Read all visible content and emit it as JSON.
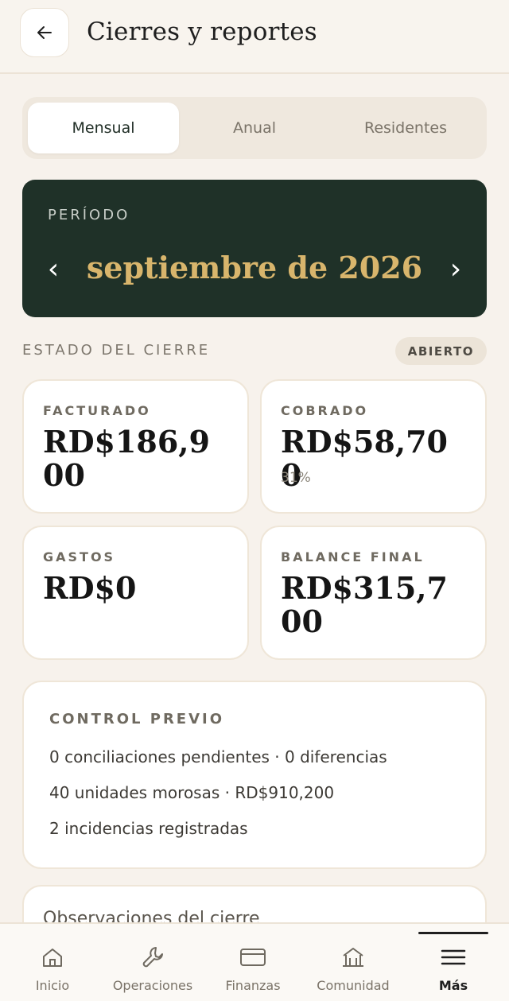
{
  "header": {
    "title": "Cierres y reportes"
  },
  "tabs": [
    {
      "label": "Mensual",
      "active": true
    },
    {
      "label": "Anual",
      "active": false
    },
    {
      "label": "Residentes",
      "active": false
    }
  ],
  "period": {
    "label": "PERÍODO",
    "value": "septiembre de 2026",
    "prev": "‹",
    "next": "›"
  },
  "status": {
    "title": "ESTADO DEL CIERRE",
    "badge": "ABIERTO"
  },
  "cards": {
    "facturado": {
      "label": "FACTURADO",
      "value": "RD$186,900"
    },
    "cobrado": {
      "label": "COBRADO",
      "value": "RD$58,700",
      "sub": "31%"
    },
    "gastos": {
      "label": "GASTOS",
      "value": "RD$0"
    },
    "balance": {
      "label": "BALANCE FINAL",
      "value": "RD$315,700"
    }
  },
  "control": {
    "title": "CONTROL PREVIO",
    "lines": [
      "0 conciliaciones pendientes · 0 diferencias",
      "40 unidades morosas · RD$910,200",
      "2 incidencias registradas"
    ]
  },
  "observations": {
    "title": "Observaciones del cierre"
  },
  "nav": {
    "items": [
      {
        "label": "Inicio",
        "icon": "home-icon"
      },
      {
        "label": "Operaciones",
        "icon": "wrench-icon"
      },
      {
        "label": "Finanzas",
        "icon": "card-icon"
      },
      {
        "label": "Comunidad",
        "icon": "building-icon"
      },
      {
        "label": "Más",
        "icon": "menu-icon",
        "active": true
      }
    ]
  },
  "colors": {
    "accent_dark": "#1f3128",
    "gold": "#d8b56c",
    "background": "#f7f2ec"
  }
}
